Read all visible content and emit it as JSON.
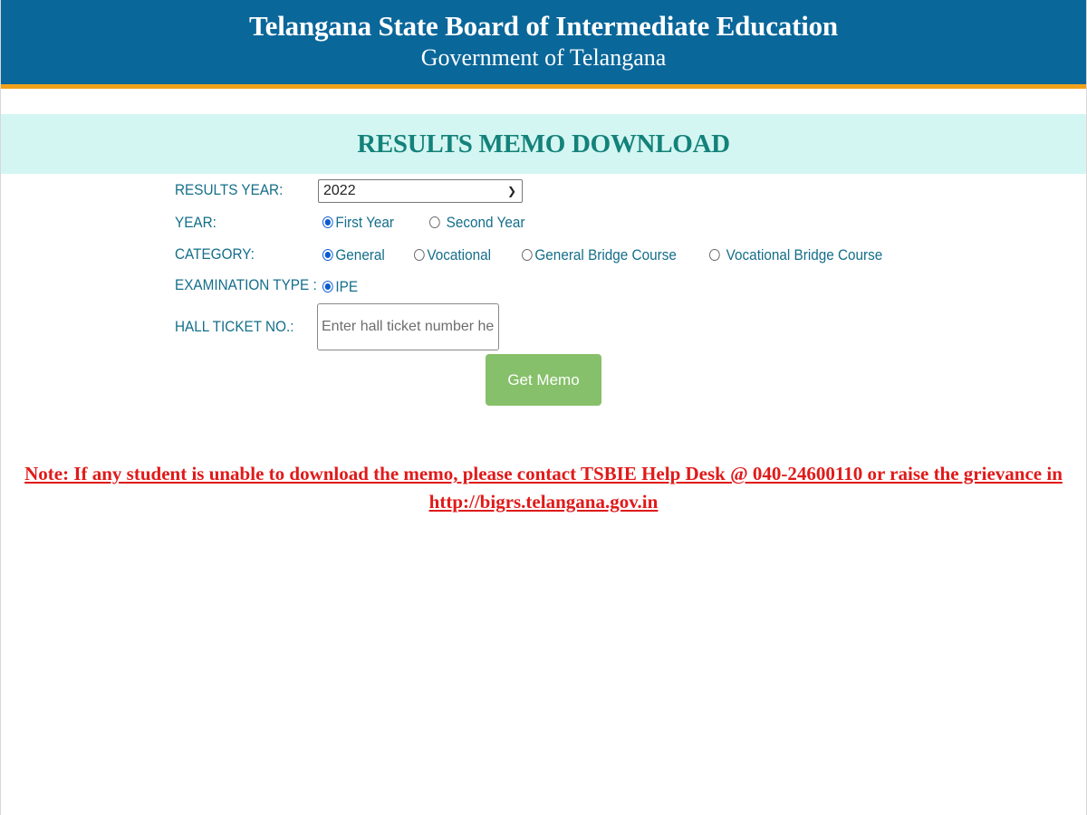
{
  "header": {
    "title": "Telangana State Board of Intermediate Education",
    "subtitle": "Government of Telangana"
  },
  "banner": {
    "heading": "RESULTS MEMO DOWNLOAD"
  },
  "form": {
    "results_year": {
      "label": "RESULTS YEAR:",
      "selected": "2022"
    },
    "year": {
      "label": "YEAR:",
      "options": [
        {
          "label": "First Year",
          "checked": true
        },
        {
          "label": "Second Year",
          "checked": false
        }
      ]
    },
    "category": {
      "label": "CATEGORY:",
      "options": [
        {
          "label": "General",
          "checked": true
        },
        {
          "label": "Vocational",
          "checked": false
        },
        {
          "label": "General Bridge Course",
          "checked": false
        },
        {
          "label": "Vocational Bridge Course",
          "checked": false
        }
      ]
    },
    "exam_type": {
      "label": "EXAMINATION TYPE :",
      "options": [
        {
          "label": "IPE",
          "checked": true
        }
      ]
    },
    "hall_ticket": {
      "label": "HALL TICKET NO.:",
      "value": "",
      "placeholder": "Enter hall ticket number here"
    },
    "submit_label": "Get Memo"
  },
  "note": {
    "text": "Note: If any student is unable to download the memo, please contact TSBIE Help Desk @ 040-24600110 or raise the grievance in",
    "link": "http://bigrs.telangana.gov.in"
  },
  "colors": {
    "header_bg": "#0a679a",
    "header_accent": "#f0a21b",
    "banner_bg": "#d4f6f3",
    "heading": "#13827a",
    "label": "#146e8a",
    "button": "#86c06a",
    "note": "#e01a1a"
  }
}
